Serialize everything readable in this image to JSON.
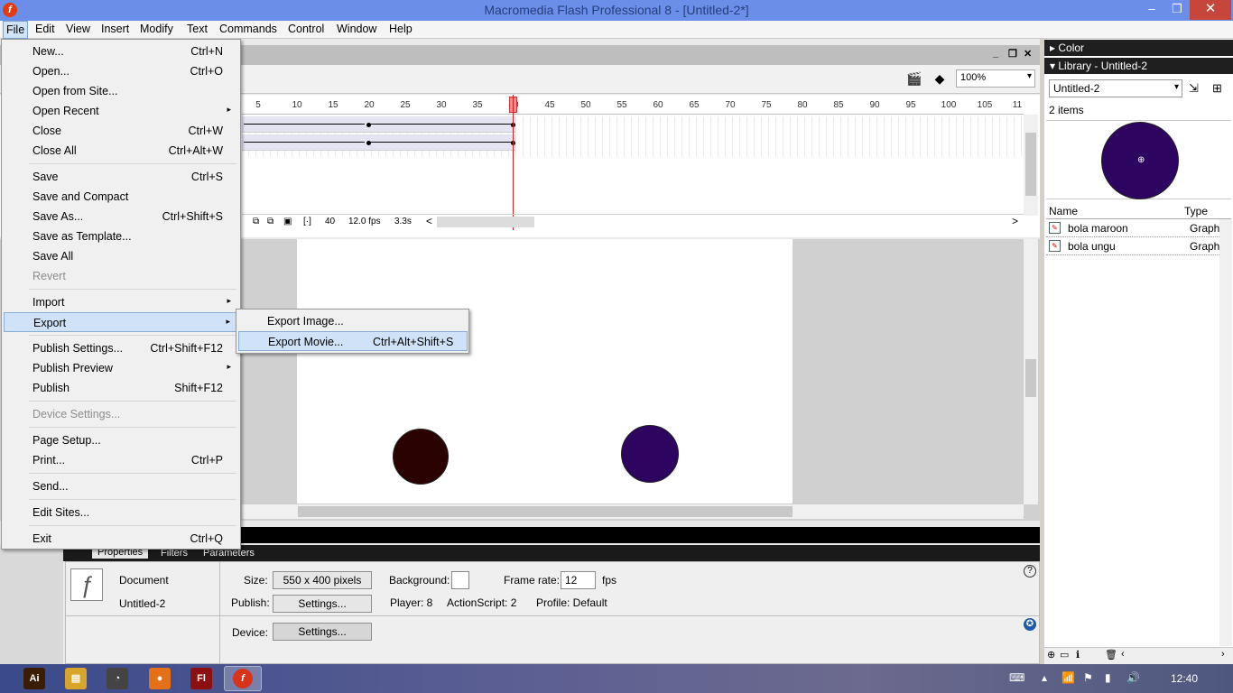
{
  "window": {
    "title": "Macromedia Flash Professional 8 - [Untitled-2*]",
    "app_icon_letter": "f",
    "controls": {
      "minimize": "–",
      "restore": "❐",
      "close": "✕"
    }
  },
  "menubar": [
    "File",
    "Edit",
    "View",
    "Insert",
    "Modify",
    "Text",
    "Commands",
    "Control",
    "Window",
    "Help"
  ],
  "doc_controls": {
    "minimize": "_",
    "restore": "❐",
    "close": "✕"
  },
  "zoom": {
    "value": "100%",
    "arrow": "▾"
  },
  "timeline": {
    "ruler_ticks": [
      "5",
      "10",
      "15",
      "20",
      "25",
      "30",
      "35",
      "40",
      "45",
      "50",
      "55",
      "60",
      "65",
      "70",
      "75",
      "80",
      "85",
      "90",
      "95",
      "100",
      "105",
      "11"
    ],
    "current_frame": "40",
    "fps": "12.0 fps",
    "elapsed": "3.3s",
    "scroll_left": "<",
    "scroll_right": ">"
  },
  "stage": {
    "balls": [
      {
        "name": "bola maroon",
        "color": "#2b0202"
      },
      {
        "name": "bola ungu",
        "color": "#2d0460"
      }
    ]
  },
  "file_menu": {
    "groups": [
      [
        {
          "label": "New...",
          "shortcut": "Ctrl+N"
        },
        {
          "label": "Open...",
          "shortcut": "Ctrl+O"
        },
        {
          "label": "Open from Site...",
          "shortcut": ""
        },
        {
          "label": "Open Recent",
          "shortcut": "",
          "submenu": "▸"
        },
        {
          "label": "Close",
          "shortcut": "Ctrl+W"
        },
        {
          "label": "Close All",
          "shortcut": "Ctrl+Alt+W"
        }
      ],
      [
        {
          "label": "Save",
          "shortcut": "Ctrl+S"
        },
        {
          "label": "Save and Compact",
          "shortcut": ""
        },
        {
          "label": "Save As...",
          "shortcut": "Ctrl+Shift+S"
        },
        {
          "label": "Save as Template...",
          "shortcut": ""
        },
        {
          "label": "Save All",
          "shortcut": ""
        },
        {
          "label": "Revert",
          "shortcut": "",
          "disabled": true
        }
      ],
      [
        {
          "label": "Import",
          "shortcut": "",
          "submenu": "▸"
        },
        {
          "label": "Export",
          "shortcut": "",
          "submenu": "▸",
          "highlighted": true
        }
      ],
      [
        {
          "label": "Publish Settings...",
          "shortcut": "Ctrl+Shift+F12"
        },
        {
          "label": "Publish Preview",
          "shortcut": "",
          "submenu": "▸"
        },
        {
          "label": "Publish",
          "shortcut": "Shift+F12"
        }
      ],
      [
        {
          "label": "Device Settings...",
          "shortcut": "",
          "disabled": true
        }
      ],
      [
        {
          "label": "Page Setup...",
          "shortcut": ""
        },
        {
          "label": "Print...",
          "shortcut": "Ctrl+P"
        }
      ],
      [
        {
          "label": "Send...",
          "shortcut": ""
        }
      ],
      [
        {
          "label": "Edit Sites...",
          "shortcut": ""
        }
      ],
      [
        {
          "label": "Exit",
          "shortcut": "Ctrl+Q"
        }
      ]
    ]
  },
  "export_submenu": [
    {
      "label": "Export Image...",
      "shortcut": ""
    },
    {
      "label": "Export Movie...",
      "shortcut": "Ctrl+Alt+Shift+S",
      "highlighted": true
    }
  ],
  "properties": {
    "tabs": [
      "Properties",
      "Filters",
      "Parameters"
    ],
    "doc_label": "Document",
    "doc_name": "Untitled-2",
    "size_label": "Size:",
    "size_value": "550 x 400 pixels",
    "background_label": "Background:",
    "frame_rate_label": "Frame rate:",
    "frame_rate_value": "12",
    "fps_unit": "fps",
    "publish_label": "Publish:",
    "settings_button": "Settings...",
    "player": "Player: 8",
    "actionscript": "ActionScript: 2",
    "profile": "Profile: Default",
    "device_label": "Device:",
    "device_button": "Settings...",
    "help_icon": "?",
    "access_icon": "✪"
  },
  "panels": {
    "color_header": "Color",
    "library_header": "Library - Untitled-2",
    "library_select": "Untitled-2",
    "item_count": "2 items",
    "col_name": "Name",
    "col_type": "Type",
    "items": [
      {
        "name": "bola maroon",
        "type": "Graph"
      },
      {
        "name": "bola ungu",
        "type": "Graph"
      }
    ]
  },
  "taskbar": {
    "apps": [
      {
        "label": "Ai",
        "color": "#3a1d05"
      },
      {
        "label": "▤",
        "color": "#d9a42a"
      },
      {
        "label": "◔",
        "color": "#444"
      },
      {
        "label": "●",
        "color": "#e4711a"
      },
      {
        "label": "Fl",
        "color": "#8e0f0f"
      },
      {
        "label": "f",
        "color": "#d9331b"
      }
    ],
    "clock": "12:40"
  }
}
